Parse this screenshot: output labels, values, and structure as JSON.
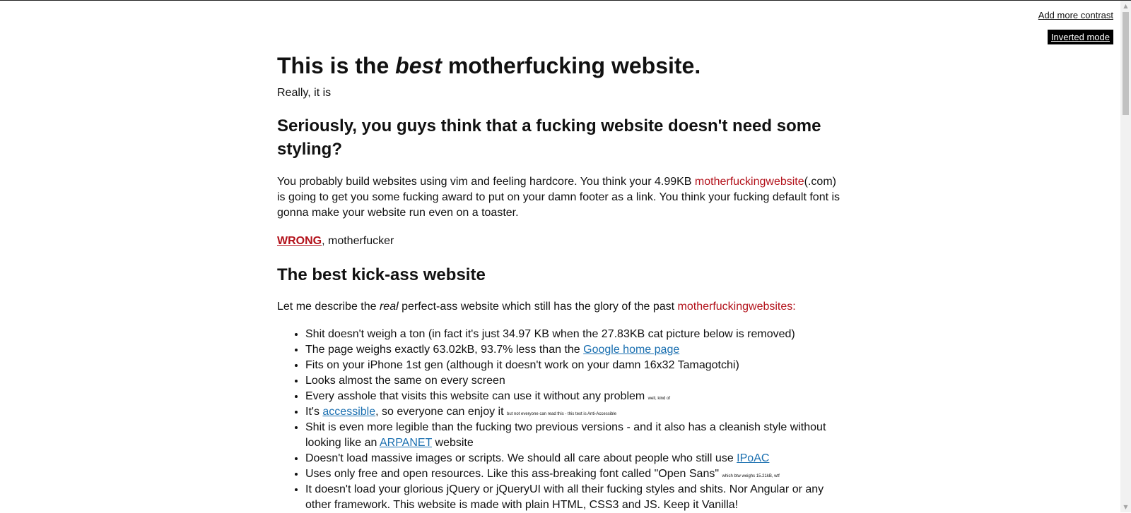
{
  "controls": {
    "contrast_label": "Add more contrast",
    "invert_label": "Inverted mode"
  },
  "header": {
    "title_pre": "This is the ",
    "title_em": "best",
    "title_post": " motherfucking website.",
    "tagline": "Really, it is"
  },
  "section1": {
    "heading": "Seriously, you guys think that a fucking website doesn't need some styling?",
    "intro_1": "You probably build websites using vim and feeling hardcore. You think your 4.99KB ",
    "intro_highlight": "motherfuckingwebsite",
    "intro_2": "(.com) is going to get you some fucking award to put on your damn footer as a link. You think your fucking default font is gonna make your website run even on a toaster.",
    "wrong_label": "WRONG",
    "wrong_suffix": ", motherfucker"
  },
  "section2": {
    "heading": "The best kick-ass website",
    "describe_1": "Let me describe the ",
    "describe_em": "real",
    "describe_2": " perfect-ass website which still has the glory of the past ",
    "describe_highlight": "motherfuckingwebsites:"
  },
  "features": [
    {
      "text": "Shit doesn't weigh a ton (in fact it's just 34.97 KB when the 27.83KB cat picture below is removed)"
    },
    {
      "pre": "The page weighs exactly 63.02kB, 93.7% less than the ",
      "link": "Google home page"
    },
    {
      "text": "Fits on your iPhone 1st gen (although it doesn't work on your damn 16x32 Tamagotchi)"
    },
    {
      "text": "Looks almost the same on every screen"
    },
    {
      "pre": "Every asshole that visits this website can use it without any problem ",
      "tiny": "well, kind of"
    },
    {
      "pre": "It's ",
      "link": "accessible",
      "post": ", so everyone can enjoy it ",
      "tiny": "but not everyone can read this - this text is Anti-Accessible"
    },
    {
      "pre": "Shit is even more legible than the fucking two previous versions - and it also has a cleanish style without looking like an ",
      "link": "ARPANET",
      "post": " website"
    },
    {
      "pre": "Doesn't load massive images or scripts. We should all care about people who still use ",
      "link": "IPoAC"
    },
    {
      "pre": "Uses only free and open resources. Like this ass-breaking font called \"Open Sans\" ",
      "tiny": "which btw weighs 15.21kB, wtf"
    },
    {
      "text": "It doesn't load your glorious jQuery or jQueryUI with all their fucking styles and shits. Nor Angular or any other framework. This website is made with plain HTML, CSS3 and JS. Keep it Vanilla!"
    }
  ]
}
